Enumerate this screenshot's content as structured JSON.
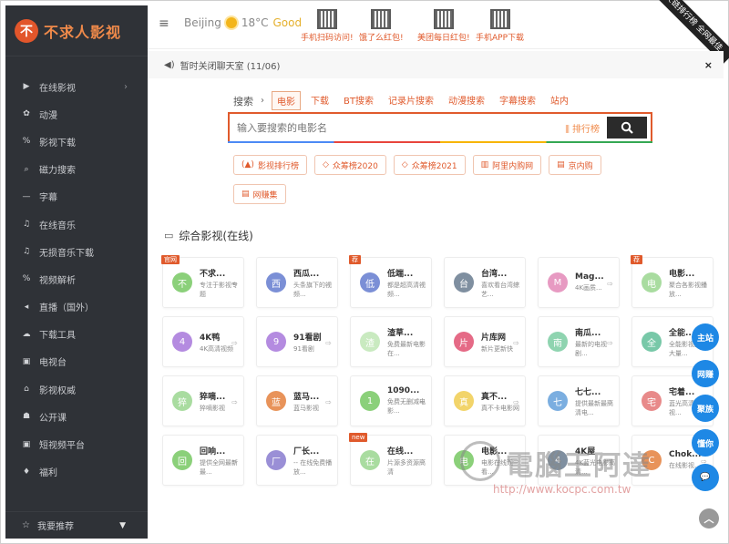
{
  "brand": {
    "logo_glyph": "不",
    "name": "不求人影视"
  },
  "sidebar": {
    "items": [
      {
        "icon": "▶",
        "icon_name": "video-icon",
        "label": "在线影视",
        "arrow": "›"
      },
      {
        "icon": "✿",
        "icon_name": "anime-icon",
        "label": "动漫"
      },
      {
        "icon": "%",
        "icon_name": "download-link-icon",
        "label": "影视下载"
      },
      {
        "icon": "⌕",
        "icon_name": "search-icon",
        "label": "磁力搜索"
      },
      {
        "icon": "—",
        "icon_name": "subtitle-icon",
        "label": "字幕"
      },
      {
        "icon": "♫",
        "icon_name": "music-icon",
        "label": "在线音乐"
      },
      {
        "icon": "♫",
        "icon_name": "lossless-music-icon",
        "label": "无损音乐下载"
      },
      {
        "icon": "%",
        "icon_name": "parse-icon",
        "label": "视频解析"
      },
      {
        "icon": "◂",
        "icon_name": "live-icon",
        "label": "直播（国外）"
      },
      {
        "icon": "☁",
        "icon_name": "cloud-download-icon",
        "label": "下载工具"
      },
      {
        "icon": "▣",
        "icon_name": "tv-icon",
        "label": "电视台"
      },
      {
        "icon": "⌂",
        "icon_name": "authority-icon",
        "label": "影视权威"
      },
      {
        "icon": "☗",
        "icon_name": "course-icon",
        "label": "公开课"
      },
      {
        "icon": "▣",
        "icon_name": "short-video-icon",
        "label": "短视频平台"
      },
      {
        "icon": "♦",
        "icon_name": "welfare-icon",
        "label": "福利"
      }
    ],
    "footer": {
      "icon": "☆",
      "label": "我要推荐",
      "caret": "▼"
    }
  },
  "topbar": {
    "menu_icon": "≡",
    "city": "Beijing",
    "temp": "18°C",
    "air": "Good",
    "qr_links": [
      "手机扫码访问!",
      "饿了么红包!",
      "美团每日红包!",
      "手机APP下载"
    ],
    "ribbon": "友链排行榜 全网最佳"
  },
  "notice": {
    "icon": "◀)",
    "text": "暂时关闭聊天室 (11/06)",
    "close": "×"
  },
  "search": {
    "label": "搜索",
    "sep": "›",
    "tabs": [
      "电影",
      "下载",
      "BT搜索",
      "记录片搜索",
      "动漫搜索",
      "字幕搜索",
      "站内"
    ],
    "placeholder": "输入要搜索的电影名",
    "rank": "排行榜",
    "rank_icon": "⫼",
    "button_icon": "🔍"
  },
  "chips": [
    {
      "icon": "(▲)",
      "label": "影视排行榜"
    },
    {
      "icon": "◇",
      "label": "众筹榜2020"
    },
    {
      "icon": "◇",
      "label": "众筹榜2021"
    },
    {
      "icon": "▥",
      "label": "阿里内购网"
    },
    {
      "icon": "▤",
      "label": "京内购"
    },
    {
      "icon": "▤",
      "label": "网赚集"
    }
  ],
  "section": {
    "icon": "▭",
    "title": "综合影视(在线)"
  },
  "cards": [
    {
      "glyph": "不",
      "color": "#8bd07a",
      "name": "不求...",
      "desc": "专注于影视专题",
      "badge": "官网"
    },
    {
      "glyph": "西",
      "color": "#7b8fd6",
      "name": "西瓜...",
      "desc": "头条旗下的视频..."
    },
    {
      "glyph": "低",
      "color": "#7b8fd6",
      "name": "低端...",
      "desc": "都是超高清视频...",
      "badge": "荐"
    },
    {
      "glyph": "台",
      "color": "#7f8fa0",
      "name": "台湾...",
      "desc": "喜欢看台湾综艺..."
    },
    {
      "glyph": "M",
      "color": "#e79ac2",
      "name": "Mag...",
      "desc": "4K画质..."
    },
    {
      "glyph": "电",
      "color": "#a9dca0",
      "name": "电影...",
      "desc": "聚合各影视播放...",
      "badge": "荐"
    },
    {
      "glyph": "4",
      "color": "#b48be0",
      "name": "4K鸭",
      "desc": "4K高清视频"
    },
    {
      "glyph": "9",
      "color": "#b48be0",
      "name": "91看剧",
      "desc": "91看剧"
    },
    {
      "glyph": "渣",
      "color": "#c9eac0",
      "name": "渣草...",
      "desc": "免费最新电影在..."
    },
    {
      "glyph": "片",
      "color": "#e56a86",
      "name": "片库网",
      "desc": "新片更新快"
    },
    {
      "glyph": "南",
      "color": "#8fd4b0",
      "name": "南瓜...",
      "desc": "最新的电视剧..."
    },
    {
      "glyph": "全",
      "color": "#78c8a8",
      "name": "全能...",
      "desc": "全能影视提供大量..."
    },
    {
      "glyph": "猝",
      "color": "#a9dca0",
      "name": "猝嘀...",
      "desc": "猝嘀影视"
    },
    {
      "glyph": "蓝",
      "color": "#e8935a",
      "name": "蓝马...",
      "desc": "蓝马影视"
    },
    {
      "glyph": "1",
      "color": "#8bd07a",
      "name": "1090...",
      "desc": "免费无删减电影..."
    },
    {
      "glyph": "真",
      "color": "#f2d46a",
      "name": "真不...",
      "desc": "真不卡电影网"
    },
    {
      "glyph": "七",
      "color": "#7baee0",
      "name": "七七...",
      "desc": "提供最新最高清电..."
    },
    {
      "glyph": "宅",
      "color": "#e88a8a",
      "name": "宅着...",
      "desc": "蓝光高清影视..."
    },
    {
      "glyph": "回",
      "color": "#8bd07a",
      "name": "回响...",
      "desc": "提供全网最新最..."
    },
    {
      "glyph": "厂",
      "color": "#9a8fd6",
      "name": "厂长...",
      "desc": "-- 在线免费播放..."
    },
    {
      "glyph": "在",
      "color": "#a9dca0",
      "name": "在线...",
      "desc": "片源多资源高清",
      "badge": "new"
    },
    {
      "glyph": "电",
      "color": "#8bd07a",
      "name": "电影...",
      "desc": "电影在线观看..."
    },
    {
      "glyph": "4",
      "color": "#7f8fa0",
      "name": "4K屋",
      "desc": "4K蓝光电影高清..."
    },
    {
      "glyph": "C",
      "color": "#e8935a",
      "name": "Chok...",
      "desc": "在线影视..."
    }
  ],
  "floats": [
    "主站",
    "网赚",
    "聚族",
    "懂你",
    "💬"
  ],
  "back_top": "︿",
  "watermark": {
    "text": "電腦王阿達",
    "url": "http://www.kocpc.com.tw"
  }
}
